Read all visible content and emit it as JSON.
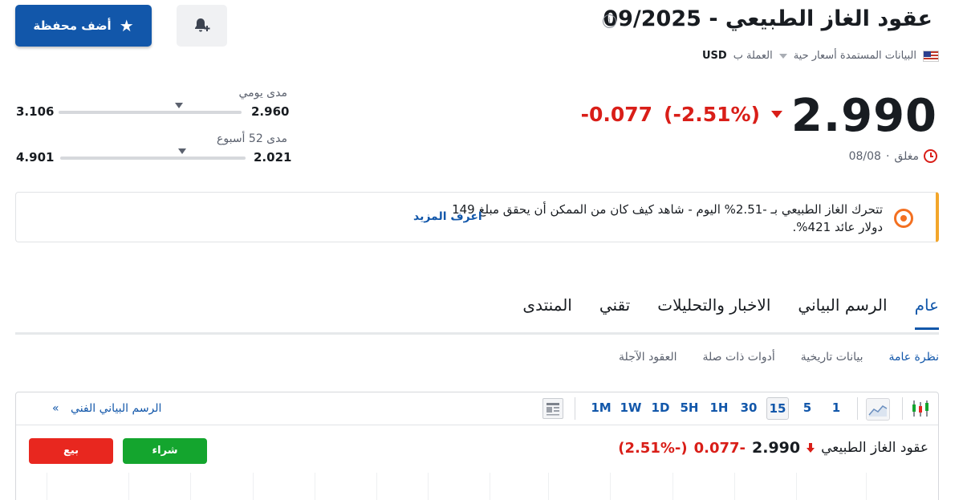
{
  "header": {
    "title": "عقود الغاز الطبيعي - 09/2025",
    "add_portfolio_label": "أضف محفظة",
    "info_glyph": "i"
  },
  "subbar": {
    "data_source": "البيانات المستمدة أسعار حية",
    "currency_label": "العملة ب",
    "currency": "USD"
  },
  "quote": {
    "price": "2.990",
    "change": "-0.077",
    "change_pct": "(-2.51%)",
    "status": "مغلق",
    "date": "08/08",
    "status_separator": "·"
  },
  "ranges": {
    "daily": {
      "label": "مدى يومي",
      "low": "2.960",
      "high": "3.106",
      "position": 0.34
    },
    "week52": {
      "label": "مدى 52 أسبوع",
      "low": "2.021",
      "high": "4.901",
      "position": 0.34
    }
  },
  "promo": {
    "text": "تتحرك الغاز الطبيعي بـ -2.51% اليوم - شاهد كيف كان من الممكن أن يحقق مبلغ 149 دولار عائد 421%.",
    "link": "اعرف المزيد"
  },
  "tabs": [
    {
      "label": "عام",
      "active": true
    },
    {
      "label": "الرسم البياني",
      "active": false
    },
    {
      "label": "الاخبار والتحليلات",
      "active": false
    },
    {
      "label": "تقني",
      "active": false
    },
    {
      "label": "المنتدى",
      "active": false
    }
  ],
  "subtabs": [
    {
      "label": "نظرة عامة",
      "active": true
    },
    {
      "label": "بيانات تاريخية",
      "active": false
    },
    {
      "label": "أدوات ذات صلة",
      "active": false
    },
    {
      "label": "العقود الآجلة",
      "active": false
    }
  ],
  "chart_toolbar": {
    "timeframes": [
      "1",
      "5",
      "15",
      "30",
      "1H",
      "5H",
      "1D",
      "1W",
      "1M"
    ],
    "selected": "15",
    "tech_chart_link": "الرسم البياني الفني",
    "tech_chart_chevron": "»"
  },
  "chart_header": {
    "name": "عقود الغاز الطبيعي",
    "price": "2.990",
    "change": "-0.077",
    "change_pct": "(-2.51%)",
    "buy_label": "شراء",
    "sell_label": "بيع"
  },
  "colors": {
    "accent": "#1257aa",
    "negative": "#d91e18",
    "buy": "#14a52e",
    "sell": "#e8271f",
    "promo_border": "#f3a62b"
  }
}
